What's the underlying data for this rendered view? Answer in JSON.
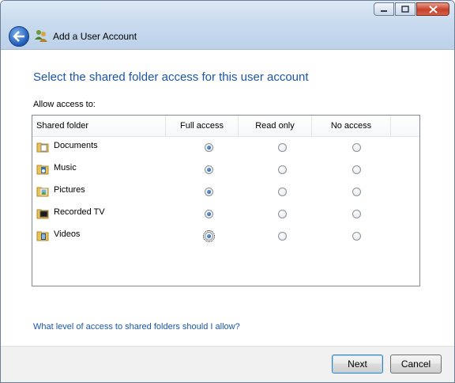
{
  "window": {
    "title": "Add a User Account"
  },
  "heading": "Select the shared folder access for this user account",
  "allow_label": "Allow access to:",
  "columns": [
    "Shared folder",
    "Full access",
    "Read only",
    "No access"
  ],
  "folders": [
    {
      "name": "Documents",
      "access": "full",
      "icon": "documents-folder-icon"
    },
    {
      "name": "Music",
      "access": "full",
      "icon": "music-folder-icon"
    },
    {
      "name": "Pictures",
      "access": "full",
      "icon": "pictures-folder-icon"
    },
    {
      "name": "Recorded TV",
      "access": "full",
      "icon": "recorded-tv-folder-icon"
    },
    {
      "name": "Videos",
      "access": "full",
      "icon": "videos-folder-icon",
      "focused": true
    }
  ],
  "help_link": "What level of access to shared folders should I allow?",
  "buttons": {
    "next": "Next",
    "cancel": "Cancel"
  },
  "colors": {
    "heading": "#1a56a8",
    "link": "#1a56a8",
    "titlebar": "#c9dbee"
  }
}
